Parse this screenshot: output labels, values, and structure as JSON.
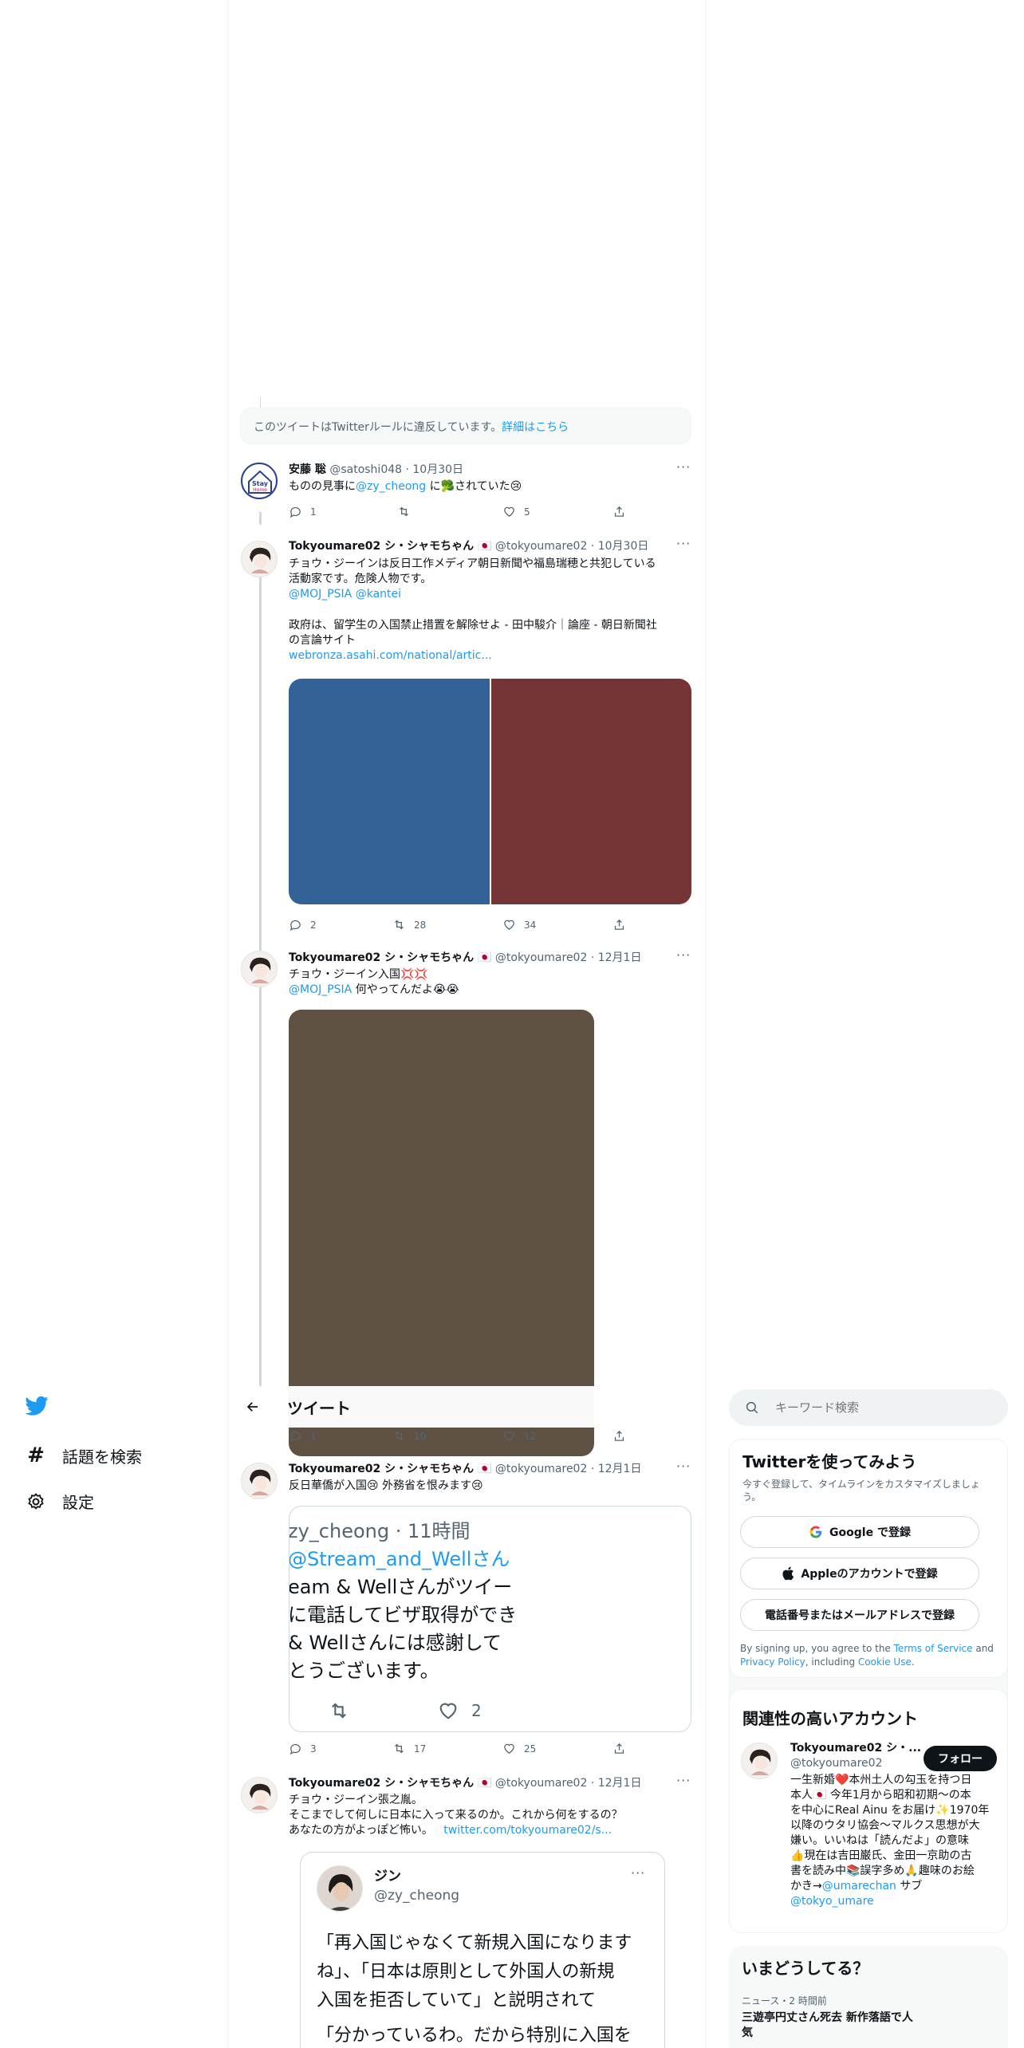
{
  "nav": {
    "explore_label": "話題を検索",
    "settings_label": "設定"
  },
  "header": {
    "title": "ツイート"
  },
  "search": {
    "placeholder": "キーワード検索"
  },
  "violation": {
    "text": "このツイートはTwitterルールに違反しています。",
    "link": "詳細はこちら"
  },
  "tweets": [
    {
      "name": "安藤 聡",
      "handle": "@satoshi048",
      "date": "· 10月30日",
      "text_pre": "ものの見事に",
      "mention": "@zy_cheong",
      "text_post": " に🥦されていた😢",
      "replies": "1",
      "retweets": "",
      "likes": "5"
    },
    {
      "name": "Tokyoumare02 シ・シャモちゃん 🇯🇵",
      "handle": "@tokyoumare02",
      "date": "· 10月30日",
      "line1": "チョウ・ジーインは反日工作メディア朝日新聞や福島瑞穂と共犯している",
      "line2": "活動家です。危険人物です。",
      "mentions": "@MOJ_PSIA  @kantei",
      "line3": "政府は、留学生の入国禁止措置を解除せよ - 田中駿介｜論座 - 朝日新聞社",
      "line4": "の言論サイト",
      "link": "webronza.asahi.com/national/artic...",
      "replies": "2",
      "retweets": "28",
      "likes": "34",
      "image_colors": [
        "#326297",
        "#753435"
      ]
    },
    {
      "name": "Tokyoumare02 シ・シャモちゃん 🇯🇵",
      "handle": "@tokyoumare02",
      "date": "· 12月1日",
      "line1": "チョウ・ジーイン入国💢💢",
      "mention": "@MOJ_PSIA",
      "line2": " 何やってんだよ😭😭",
      "replies": "1",
      "retweets": "10",
      "likes": "12",
      "image_color": "#5f5244"
    },
    {
      "name": "Tokyoumare02 シ・シャモちゃん 🇯🇵",
      "handle": "@tokyoumare02",
      "date": "· 12月1日",
      "line1": "反日華僑が入国😢 外務省を恨みます😢",
      "quote_header": "zy_cheong · 11時間",
      "quote_mention": "@Stream_and_Wellさん",
      "quote_l1": "eam & Wellさんがツイー",
      "quote_l2": "に電話してビザ取得ができ",
      "quote_l3": "& Wellさんには感謝して",
      "quote_l4": "とうございます。",
      "quote_likes": "2",
      "replies": "3",
      "retweets": "17",
      "likes": "25"
    },
    {
      "name": "Tokyoumare02 シ・シャモちゃん 🇯🇵",
      "handle": "@tokyoumare02",
      "date": "· 12月1日",
      "line1": "チョウ・ジーイン張之胤。",
      "line2": "そこまでして何しに日本に入って来るのか。これから何をするの？",
      "line3": "あなたの方がよっぽど怖い。",
      "link": "twitter.com/tokyoumare02/s...",
      "quote_name": "ジン",
      "quote_handle": "@zy_cheong",
      "quote_l1": "「再入国じゃなくて新規入国になります",
      "quote_l2": "ね」、「日本は原則として外国人の新規",
      "quote_l3": "入国を拒否していて」と説明されて",
      "quote_l4": "「分かっているわ。だから特別に入国を"
    }
  ],
  "signup": {
    "title": "Twitterを使ってみよう",
    "subtitle_l1": "今すぐ登録して、タイムラインをカスタマイズしましょ",
    "subtitle_l2": "う。",
    "google": "Google で登録",
    "apple": "Appleのアカウントで登録",
    "phone": "電話番号またはメールアドレスで登録",
    "legal_pre": "By signing up, you agree to the ",
    "tos": "Terms of Service",
    "legal_and": " and",
    "privacy": "Privacy Policy",
    "legal_inc": ", including ",
    "cookie": "Cookie Use",
    "legal_end": "."
  },
  "relevant": {
    "title": "関連性の高いアカウント",
    "name": "Tokyoumare02 シ・...",
    "handle": "@tokyoumare02",
    "follow": "フォロー",
    "bio_l1": "一生新婚❤️本州土人の勾玉を持つ日",
    "bio_l2": "本人🇯🇵 今年1月から昭和初期〜の本",
    "bio_l3": "を中心にReal Ainu をお届け✨1970年",
    "bio_l4": "以降のウタリ協会〜マルクス思想が大",
    "bio_l5": "嫌い。いいねは「読んだよ」の意味",
    "bio_l6": "👍現在は吉田巌氏、金田一京助の古",
    "bio_l7": "書を読み中📚誤字多め🙏趣味のお絵",
    "bio_l8_pre": "かき→",
    "bio_l8_link": "@umarechan",
    "bio_l8_post": " サブ",
    "bio_l9": "@tokyo_umare"
  },
  "trends": {
    "title": "いまどうしてる？",
    "meta": "ニュース・2 時間前",
    "headline_l1": "三遊亭円丈さん死去 新作落語で人",
    "headline_l2": "気"
  },
  "colors": {
    "accent": "#1d9bf0",
    "border": "#eff3f4"
  }
}
